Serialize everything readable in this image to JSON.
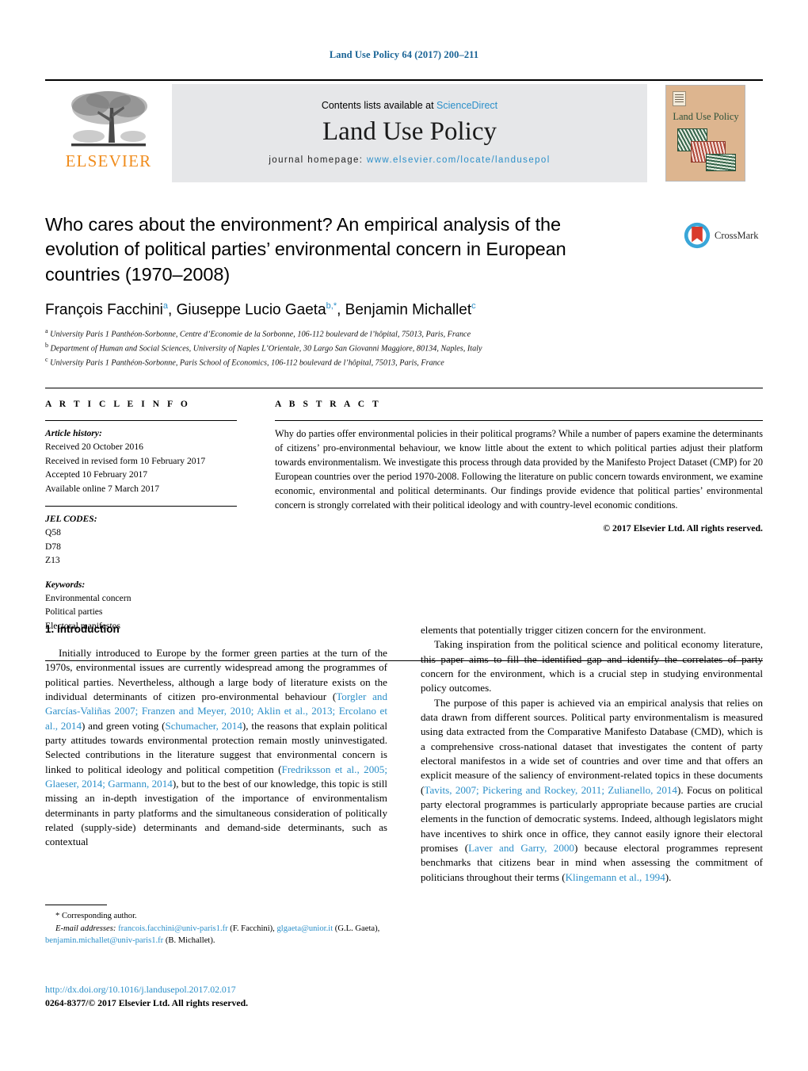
{
  "running_head": "Land Use Policy 64 (2017) 200–211",
  "masthead": {
    "publisher_name": "ELSEVIER",
    "contents_prefix": "Contents lists available at ",
    "contents_link": "ScienceDirect",
    "journal_name": "Land Use Policy",
    "homepage_prefix": "journal homepage: ",
    "homepage_url": "www.elsevier.com/locate/landusepol",
    "cover_title": "Land Use Policy"
  },
  "article": {
    "title": "Who cares about the environment? An empirical analysis of the evolution of political parties’ environmental concern in European countries (1970–2008)",
    "crossmark_label": "CrossMark",
    "authors_html": "François Facchini<sup>a</sup>, Giuseppe Lucio Gaeta<sup>b,*</sup>, Benjamin Michallet<sup>c</sup>",
    "affiliations": [
      "University Paris 1 Panthéon-Sorbonne, Centre d’Economie de la Sorbonne, 106-112 boulevard de l’hôpital, 75013, Paris, France",
      "Department of Human and Social Sciences, University of Naples L’Orientale, 30 Largo San Giovanni Maggiore, 80134, Naples, Italy",
      "University Paris 1 Panthéon-Sorbonne, Paris School of Economics, 106-112 boulevard de l’hôpital, 75013, Paris, France"
    ],
    "affiliation_markers": [
      "a",
      "b",
      "c"
    ]
  },
  "info": {
    "heading": "A R T I C L E   I N F O",
    "history_label": "Article history:",
    "history": [
      "Received 20 October 2016",
      "Received in revised form 10 February 2017",
      "Accepted 10 February 2017",
      "Available online 7 March 2017"
    ],
    "jel_label": "JEL CODES:",
    "jel_codes": [
      "Q58",
      "D78",
      "Z13"
    ],
    "keywords_label": "Keywords:",
    "keywords": [
      "Environmental concern",
      "Political parties",
      "Electoral manifestos"
    ]
  },
  "abstract": {
    "heading": "A B S T R A C T",
    "text": "Why do parties offer environmental policies in their political programs? While a number of papers examine the determinants of citizens’ pro-environmental behaviour, we know little about the extent to which political parties adjust their platform towards environmentalism. We investigate this process through data provided by the Manifesto Project Dataset (CMP) for 20 European countries over the period 1970-2008. Following the literature on public concern towards environment, we examine economic, environmental and political determinants. Our findings provide evidence that political parties’ environmental concern is strongly correlated with their political ideology and with country-level economic conditions.",
    "copyright": "© 2017 Elsevier Ltd. All rights reserved."
  },
  "body": {
    "section_number_title": "1.  Introduction",
    "left_paragraphs": [
      {
        "runs": [
          {
            "t": "Initially introduced to Europe by the former green parties at the turn of the 1970s, environmental issues are currently widespread among the programmes of political parties. Nevertheless, although a large body of literature exists on the individual determinants of citizen pro-environmental behaviour (",
            "link": false
          },
          {
            "t": "Torgler and Garcías-Valiñas 2007; Franzen and Meyer, 2010; Aklin et al., 2013; Ercolano et al., 2014",
            "link": true
          },
          {
            "t": ") and green voting (",
            "link": false
          },
          {
            "t": "Schumacher, 2014",
            "link": true
          },
          {
            "t": "), the reasons that explain political party attitudes towards environmental protection remain mostly uninvestigated. Selected contributions in the literature suggest that environmental concern is linked to political ideology and political competition (",
            "link": false
          },
          {
            "t": "Fredriksson et al., 2005; Glaeser, 2014; Garmann, 2014",
            "link": true
          },
          {
            "t": "), but to the best of our knowledge, this topic is still missing an in-depth investigation of the importance of environmentalism determinants in party platforms and the simultaneous consideration of politically related (supply-side) determinants and demand-side determinants, such as contextual",
            "link": false
          }
        ]
      }
    ],
    "right_paragraphs": [
      {
        "no_indent": true,
        "runs": [
          {
            "t": "elements that potentially trigger citizen concern for the environment.",
            "link": false
          }
        ]
      },
      {
        "runs": [
          {
            "t": "Taking inspiration from the political science and political economy literature, this paper aims to fill the identified gap and identify the correlates of party concern for the environment, which is a crucial step in studying environmental policy outcomes.",
            "link": false
          }
        ]
      },
      {
        "runs": [
          {
            "t": "The purpose of this paper is achieved via an empirical analysis that relies on data drawn from different sources. Political party environmentalism is measured using data extracted from the Comparative Manifesto Database (CMD), which is a comprehensive cross-national dataset that investigates the content of party electoral manifestos in a wide set of countries and over time and that offers an explicit measure of the saliency of environment-related topics in these documents (",
            "link": false
          },
          {
            "t": "Tavits, 2007; Pickering and Rockey, 2011; Zulianello, 2014",
            "link": true
          },
          {
            "t": "). Focus on political party electoral programmes is particularly appropriate because parties are crucial elements in the function of democratic systems. Indeed, although legislators might have incentives to shirk once in office, they cannot easily ignore their electoral promises (",
            "link": false
          },
          {
            "t": "Laver and Garry, 2000",
            "link": true
          },
          {
            "t": ") because electoral programmes represent benchmarks that citizens bear in mind when assessing the commitment of politicians throughout their terms (",
            "link": false
          },
          {
            "t": "Klingemann et al., 1994",
            "link": true
          },
          {
            "t": ").",
            "link": false
          }
        ]
      }
    ]
  },
  "footnote": {
    "corresponding": "* Corresponding author.",
    "email_label": "E-mail addresses:",
    "emails": [
      {
        "addr": "francois.facchini@univ-paris1.fr",
        "who": " (F. Facchini), "
      },
      {
        "addr": "glgaeta@unior.it",
        "who": " (G.L. Gaeta), "
      },
      {
        "addr": "benjamin.michallet@univ-paris1.fr",
        "who": " (B. Michallet)."
      }
    ]
  },
  "doi": {
    "url": "http://dx.doi.org/10.1016/j.landusepol.2017.02.017",
    "issn_line": "0264-8377/© 2017 Elsevier Ltd. All rights reserved."
  },
  "colors": {
    "link_blue": "#2b8fc9",
    "running_head_blue": "#1a6496",
    "elsevier_orange": "#F08C1C",
    "masthead_gray": "#e6e7e9",
    "cover_tan": "#ddb58f"
  }
}
